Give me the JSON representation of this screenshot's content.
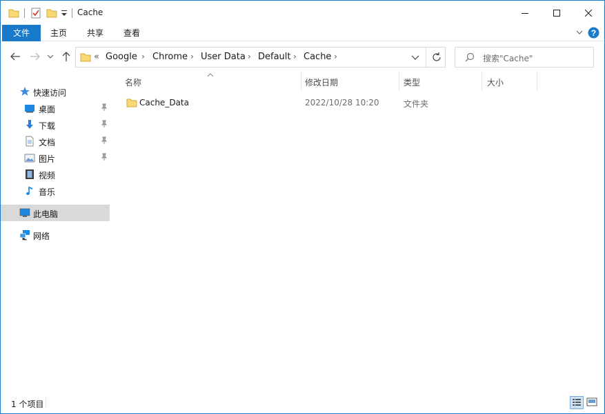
{
  "window": {
    "title": "Cache"
  },
  "ribbon": {
    "tabs": [
      "文件",
      "主页",
      "共享",
      "查看"
    ]
  },
  "address": {
    "overflow_symbol": "«",
    "crumbs": [
      "Google",
      "Chrome",
      "User Data",
      "Default",
      "Cache"
    ]
  },
  "search": {
    "placeholder": "搜索\"Cache\""
  },
  "nav": {
    "quick_access": "快速访问",
    "items": [
      {
        "label": "桌面",
        "icon": "desktop-icon",
        "pinned": true
      },
      {
        "label": "下载",
        "icon": "download-icon",
        "pinned": true
      },
      {
        "label": "文档",
        "icon": "document-icon",
        "pinned": true
      },
      {
        "label": "图片",
        "icon": "pictures-icon",
        "pinned": true
      },
      {
        "label": "视频",
        "icon": "video-icon",
        "pinned": false
      },
      {
        "label": "音乐",
        "icon": "music-icon",
        "pinned": false
      }
    ],
    "this_pc": "此电脑",
    "network": "网络"
  },
  "columns": {
    "name": "名称",
    "date": "修改日期",
    "type": "类型",
    "size": "大小"
  },
  "files": [
    {
      "name": "Cache_Data",
      "date": "2022/10/28 10:20",
      "type": "文件夹",
      "icon": "folder-icon"
    }
  ],
  "status": {
    "text": "1 个项目"
  },
  "colors": {
    "accent": "#1979ca",
    "selection": "#d9d9d9",
    "folder": "#f8d775"
  }
}
